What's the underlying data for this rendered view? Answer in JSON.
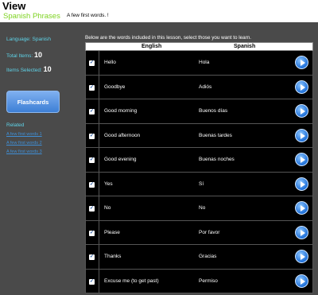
{
  "header": {
    "title": "View",
    "subtitle": "Spanish Phrases",
    "note": "A few first words. !"
  },
  "sidebar": {
    "language_label": "Language: Spanish",
    "total_label": "Total Items:",
    "total_value": "10",
    "selected_label": "Items Selected:",
    "selected_value": "10",
    "flashcards_label": "Flashcards",
    "related_title": "Related",
    "related_links": [
      "A few first words 1",
      "A few first words 2",
      "A few first words 3"
    ]
  },
  "main": {
    "intro": "Below are the words included in this lesson, select those you want to learn.",
    "columns": [
      "English",
      "Spanish"
    ],
    "rows": [
      {
        "english": "Hello",
        "spanish": "Hola"
      },
      {
        "english": "Goodbye",
        "spanish": "Adiós"
      },
      {
        "english": "Good morning",
        "spanish": "Buenos días"
      },
      {
        "english": "Good afternoon",
        "spanish": "Buenas tardes"
      },
      {
        "english": "Good evening",
        "spanish": "Buenas noches"
      },
      {
        "english": "Yes",
        "spanish": "Sí"
      },
      {
        "english": "No",
        "spanish": "No"
      },
      {
        "english": "Please",
        "spanish": "Por favor"
      },
      {
        "english": "Thanks",
        "spanish": "Gracias"
      },
      {
        "english": "Excuse me (to get past)",
        "spanish": "Permiso"
      }
    ],
    "check_glyph": "✓"
  },
  "colors": {
    "accent_green": "#7ed321",
    "accent_cyan": "#5fd3e8",
    "panel_bg": "#4a4a4a",
    "button_blue": "#3d7fd6"
  }
}
